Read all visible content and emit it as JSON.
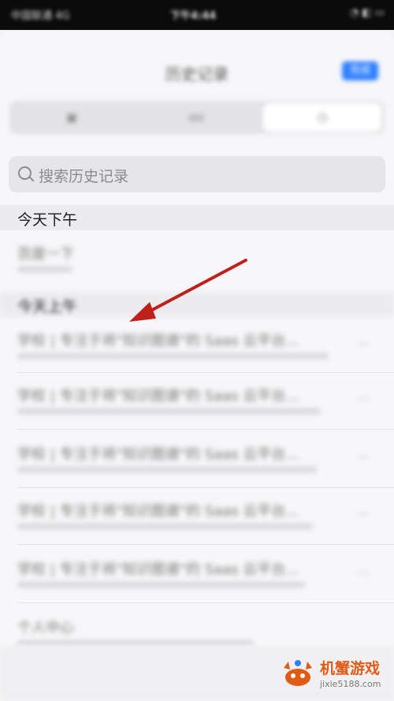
{
  "status_bar": {
    "carrier": "中国联通 4G",
    "time": "下午4:44",
    "battery": "◔ ◧ ▭"
  },
  "nav": {
    "title": "历史记录",
    "done_label": "完成"
  },
  "segments": [
    {
      "label": "▣"
    },
    {
      "label": "oo"
    },
    {
      "label": "◷"
    }
  ],
  "search": {
    "placeholder": "搜索历史记录"
  },
  "sections": [
    {
      "header": "今天下午",
      "items": [
        {
          "title": "百度一下",
          "more": ""
        }
      ]
    },
    {
      "header": "今天上午",
      "items": [
        {
          "title": "学校 | 专注于将\"知识图谱\"的 Saas 云平台...",
          "more": "..."
        },
        {
          "title": "学校 | 专注于将\"知识图谱\"的 Saas 云平台...",
          "more": "..."
        },
        {
          "title": "学校 | 专注于将\"知识图谱\"的 Saas 云平台...",
          "more": "..."
        },
        {
          "title": "学校 | 专注于将\"知识图谱\"的 Saas 云平台...",
          "more": "..."
        },
        {
          "title": "学校 | 专注于将\"知识图谱\"的 Saas 云平台...",
          "more": "..."
        },
        {
          "title": "个人中心",
          "more": ""
        }
      ]
    }
  ],
  "watermark": {
    "name": "机蟹游戏",
    "url": "jixie5188.com"
  },
  "colors": {
    "accent": "#2f80ff",
    "arrow": "#c0201c",
    "watermark": "#e15a16"
  }
}
